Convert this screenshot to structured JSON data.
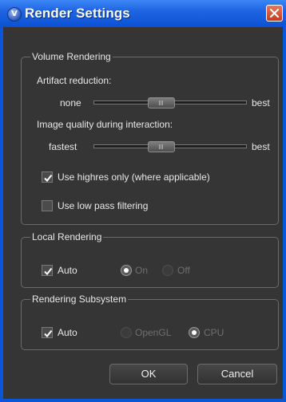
{
  "window": {
    "title": "Render Settings",
    "app_icon_glyph": "V",
    "colors": {
      "titlebar": "#0b52d2",
      "panel": "#353535",
      "close": "#c83a1c"
    }
  },
  "volume": {
    "title": "Volume Rendering",
    "artifact_label": "Artifact reduction:",
    "artifact_min": "none",
    "artifact_max": "best",
    "quality_label": "Image quality during interaction:",
    "quality_min": "fastest",
    "quality_max": "best",
    "highres_label": "Use highres only (where applicable)",
    "highres_checked": true,
    "lowpass_label": "Use low pass filtering",
    "lowpass_checked": false
  },
  "local": {
    "title": "Local Rendering",
    "auto_label": "Auto",
    "auto_checked": true,
    "on_label": "On",
    "off_label": "Off",
    "selected": "On"
  },
  "subsystem": {
    "title": "Rendering Subsystem",
    "auto_label": "Auto",
    "auto_checked": true,
    "opengl_label": "OpenGL",
    "cpu_label": "CPU",
    "selected": "CPU"
  },
  "buttons": {
    "ok": "OK",
    "cancel": "Cancel"
  },
  "icons": [
    "app-logo-icon",
    "close-icon",
    "checkmark-icon",
    "slider-grip-icon",
    "radio-dot-icon"
  ]
}
